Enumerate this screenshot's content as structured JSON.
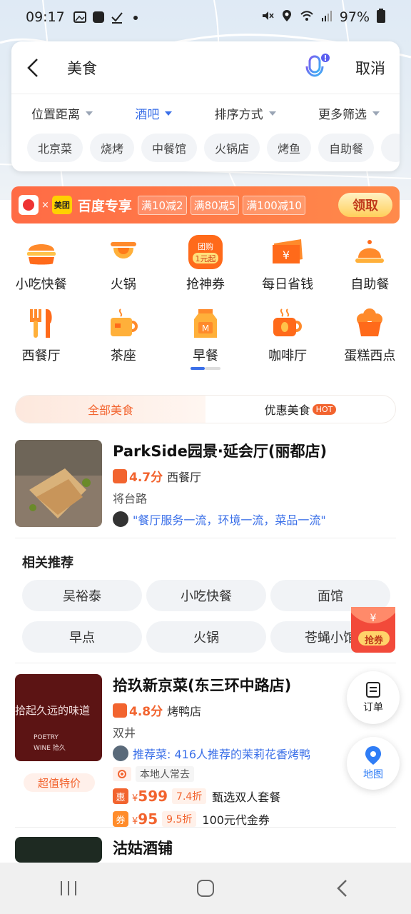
{
  "status": {
    "time": "09:17",
    "battery": "97%"
  },
  "search": {
    "query": "美食",
    "cancel_label": "取消"
  },
  "filters": [
    {
      "label": "位置距离",
      "active": false
    },
    {
      "label": "酒吧",
      "active": true
    },
    {
      "label": "排序方式",
      "active": false
    },
    {
      "label": "更多筛选",
      "active": false
    }
  ],
  "chips": [
    "北京菜",
    "烧烤",
    "中餐馆",
    "火锅店",
    "烤鱼",
    "自助餐"
  ],
  "promo": {
    "partner": "美团",
    "title": "百度专享",
    "coupons": [
      "满10减2",
      "满80减5",
      "满100减10"
    ],
    "claim_label": "领取"
  },
  "categories": [
    {
      "label": "小吃快餐",
      "icon": "burger-icon"
    },
    {
      "label": "火锅",
      "icon": "hotpot-icon"
    },
    {
      "label": "抢神券",
      "icon": "group-coupon-icon",
      "badge_line1": "团购",
      "badge_line2": "1元起"
    },
    {
      "label": "每日省钱",
      "icon": "ticket-icon"
    },
    {
      "label": "自助餐",
      "icon": "buffet-icon"
    },
    {
      "label": "西餐厅",
      "icon": "fork-knife-icon"
    },
    {
      "label": "茶座",
      "icon": "tea-icon"
    },
    {
      "label": "早餐",
      "icon": "milk-icon",
      "badge": "M"
    },
    {
      "label": "咖啡厅",
      "icon": "coffee-icon"
    },
    {
      "label": "蛋糕西点",
      "icon": "cake-icon"
    }
  ],
  "tabs": {
    "all": "全部美食",
    "deals": "优惠美食",
    "hot": "HOT"
  },
  "listing1": {
    "name": "ParkSide园景·延会厅(丽都店)",
    "rating": "4.7分",
    "category": "西餐厅",
    "area": "将台路",
    "review": "\"餐厅服务一流，环境一流，菜品一流\""
  },
  "related": {
    "title": "相关推荐",
    "items": [
      "吴裕泰",
      "小吃快餐",
      "面馆",
      "早点",
      "火锅",
      "苍蝇小馆"
    ]
  },
  "listing2": {
    "name": "拾玖新京菜(东三环中路店)",
    "rating": "4.8分",
    "category": "烤鸭店",
    "area": "双井",
    "recommend": "推荐菜: 416人推荐的茉莉花香烤鸭",
    "local_tag": "本地人常去",
    "thumb_text": "拾起久远的味道",
    "thumb_sub1": "POETRY",
    "thumb_sub2": "WINE 拾久",
    "special": "超值特价",
    "deals": [
      {
        "badge": "惠",
        "currency": "¥",
        "price": "599",
        "discount": "7.4折",
        "name": "甄选双人套餐"
      },
      {
        "badge": "券",
        "currency": "¥",
        "price": "95",
        "discount": "9.5折",
        "name": "100元代金券"
      }
    ]
  },
  "listing3": {
    "name": "沽姑酒铺"
  },
  "floating": {
    "coupon_label": "抢券",
    "order_label": "订单",
    "map_label": "地图"
  },
  "colors": {
    "accent": "#f2642f",
    "blue": "#3a6fe8"
  }
}
